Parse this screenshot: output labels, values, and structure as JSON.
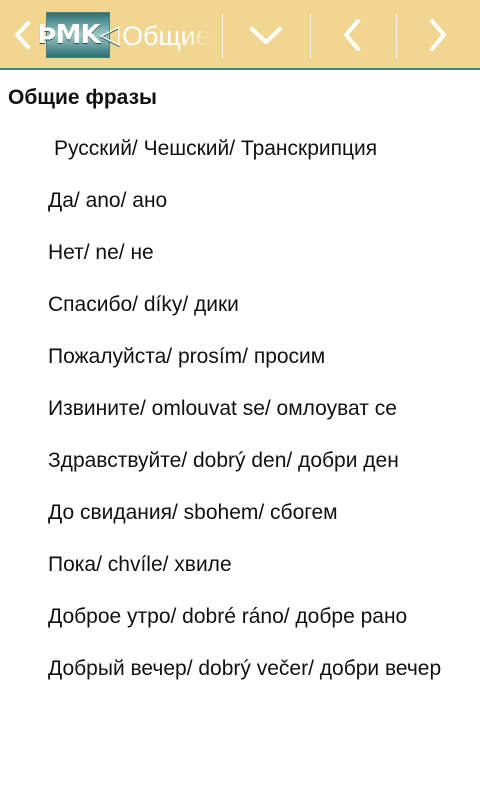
{
  "toolbar": {
    "logo_text": "ÞMK◁",
    "title": "Общие фразы",
    "icons": [
      "back-icon",
      "chevron-down-icon",
      "chevron-left-icon",
      "chevron-right-icon"
    ],
    "background": "#f0d690",
    "accent": "#2f8b8b"
  },
  "content": {
    "heading": "Общие фразы",
    "rows": [
      "  Русский/   Чешский/   Транскрипция",
      "Да/    ano/  ано",
      "Нет/  ne/ не",
      "Спасибо/   díky/ дики",
      "Пожалуйста/   prosím/    просим",
      "Извините/ omlouvat se/    омлоуват се",
      "Здравствуйте/  dobrý den/ добри ден",
      "До свидания/  sbohem/ сбогем",
      "Пока/   chvíle/  хвиле",
      "Доброе утро/  dobré ráno/   добре рано",
      "Добрый вечер/  dobrý večer/  добри вечер"
    ]
  }
}
